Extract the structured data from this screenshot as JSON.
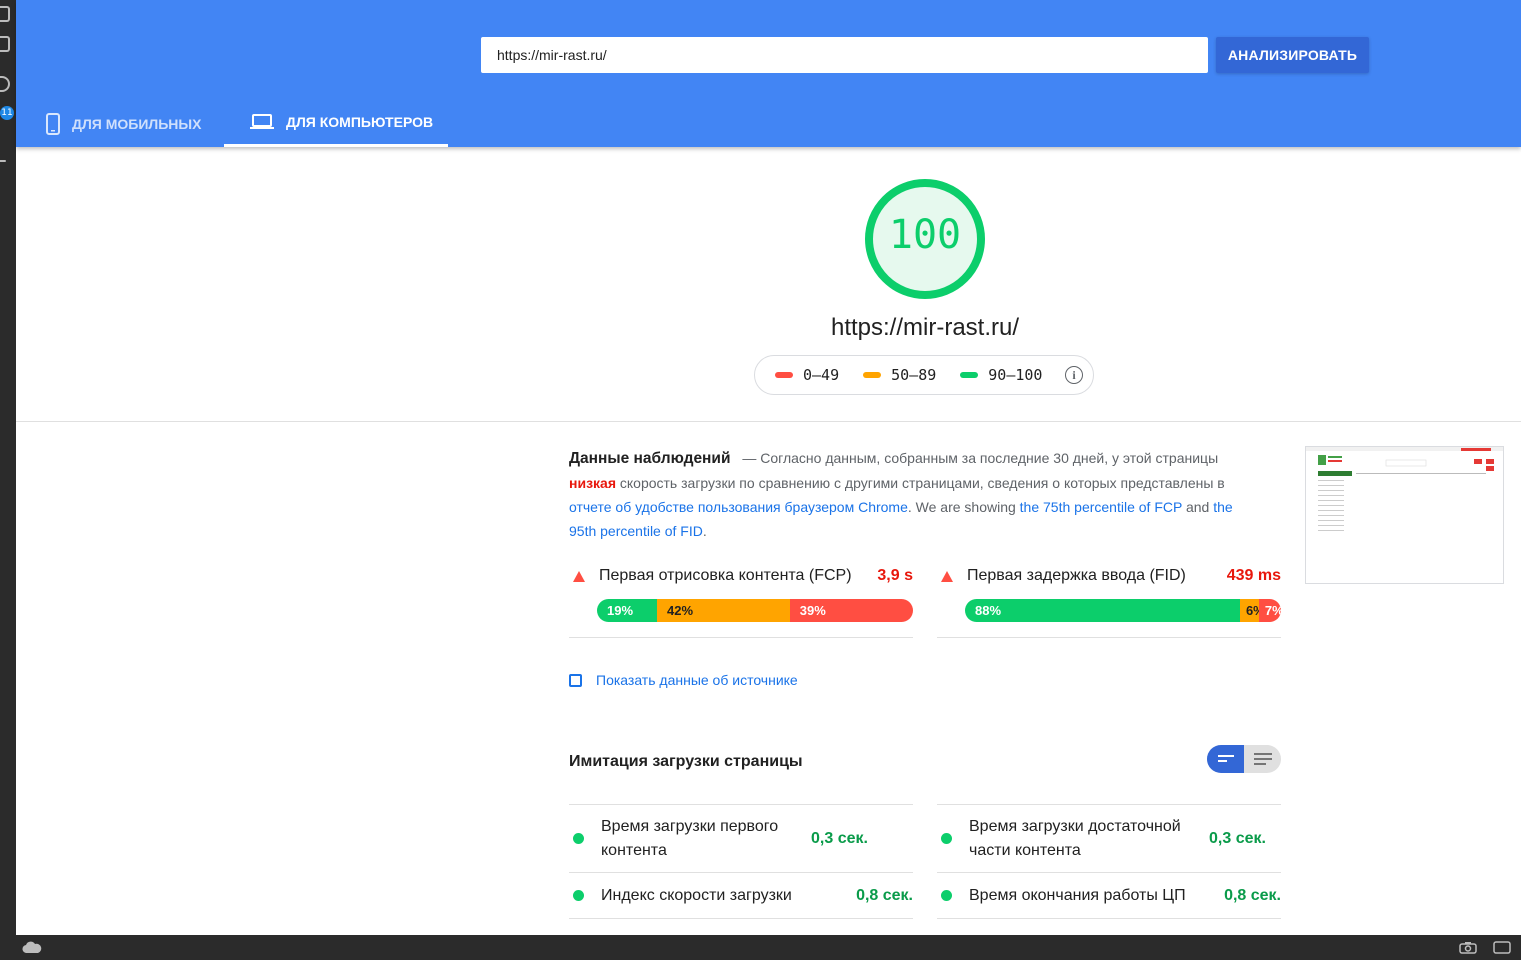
{
  "header": {
    "url_value": "https://mir-rast.ru/",
    "analyze_label": "АНАЛИЗИРОВАТЬ",
    "tabs": [
      {
        "label": "ДЛЯ МОБИЛЬНЫХ",
        "icon": "smartphone-icon",
        "active": false
      },
      {
        "label": "ДЛЯ КОМПЬЮТЕРОВ",
        "icon": "laptop-icon",
        "active": true
      }
    ],
    "color": "#4285f4"
  },
  "os": {
    "badge": "11"
  },
  "score": {
    "value": "100",
    "fraction": 1.0,
    "url": "https://mir-rast.ru/",
    "legend": [
      {
        "label": "0–49",
        "color": "#ff4e42"
      },
      {
        "label": "50–89",
        "color": "#ffa400"
      },
      {
        "label": "90–100",
        "color": "#0cce6b"
      }
    ]
  },
  "field_data": {
    "title": "Данные наблюдений",
    "text_1": "— Согласно данным, собранным за последние 30 дней, у этой страницы",
    "rating": "низкая",
    "text_2": "скорость загрузки по сравнению с другими страницами, сведения о которых представлены в",
    "link_1": "отчете об удобстве пользования браузером Chrome",
    "text_3": ". We are showing",
    "link_2": "the 75th percentile of FCP",
    "text_4": "and",
    "link_3": "the 95th percentile of FID",
    "text_5": ".",
    "metrics": [
      {
        "label": "Первая отрисовка контента (FCP)",
        "value": "3,9 s",
        "distribution": [
          {
            "pct": "19%",
            "fraction": 0.19
          },
          {
            "pct": "42%",
            "fraction": 0.42
          },
          {
            "pct": "39%",
            "fraction": 0.39
          }
        ]
      },
      {
        "label": "Первая задержка ввода (FID)",
        "value": "439 ms",
        "distribution": [
          {
            "pct": "88%",
            "fraction": 0.88
          },
          {
            "pct": "6%",
            "fraction": 0.06
          },
          {
            "pct": "7%",
            "fraction": 0.07
          }
        ]
      }
    ],
    "show_origin": "Показать данные об источнике"
  },
  "lab_data": {
    "title": "Имитация загрузки страницы",
    "metrics": [
      {
        "label": "Время загрузки первого контента",
        "value": "0,3 сек."
      },
      {
        "label": "Время загрузки достаточной части контента",
        "value": "0,3 сек."
      },
      {
        "label": "Индекс скорости загрузки",
        "value": "0,8 сек."
      },
      {
        "label": "Время окончания работы ЦП",
        "value": "0,8 сек."
      }
    ]
  }
}
